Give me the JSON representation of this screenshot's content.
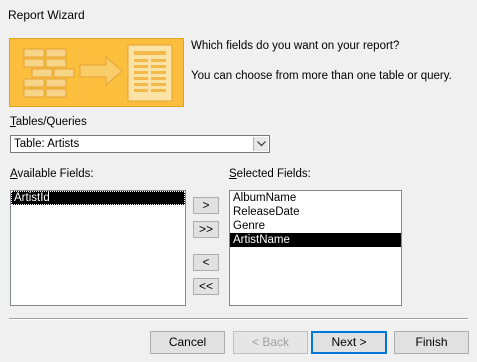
{
  "window": {
    "title": "Report Wizard"
  },
  "banner": {
    "line1": "Which fields do you want on your report?",
    "line2": "You can choose from more than one table or query."
  },
  "tables_queries": {
    "label": "Tables/Queries",
    "label_accesskey": "T",
    "label_rest": "ables/Queries",
    "selected": "Table: Artists"
  },
  "available": {
    "label_accesskey": "A",
    "label_rest": "vailable Fields:",
    "items": [
      "ArtistId"
    ]
  },
  "selected_fields": {
    "label_accesskey": "S",
    "label_rest": "elected Fields:",
    "items": [
      "AlbumName",
      "ReleaseDate",
      "Genre",
      "ArtistName"
    ]
  },
  "move_buttons": {
    "add_one": ">",
    "add_all": ">>",
    "remove_one": "<",
    "remove_all": "<<"
  },
  "footer": {
    "cancel": "Cancel",
    "back": "< Back",
    "next": "Next >",
    "finish": "Finish"
  },
  "colors": {
    "banner_bg": "#fbbf3d",
    "selection_bg": "#000000",
    "default_button_border": "#0078d7"
  }
}
